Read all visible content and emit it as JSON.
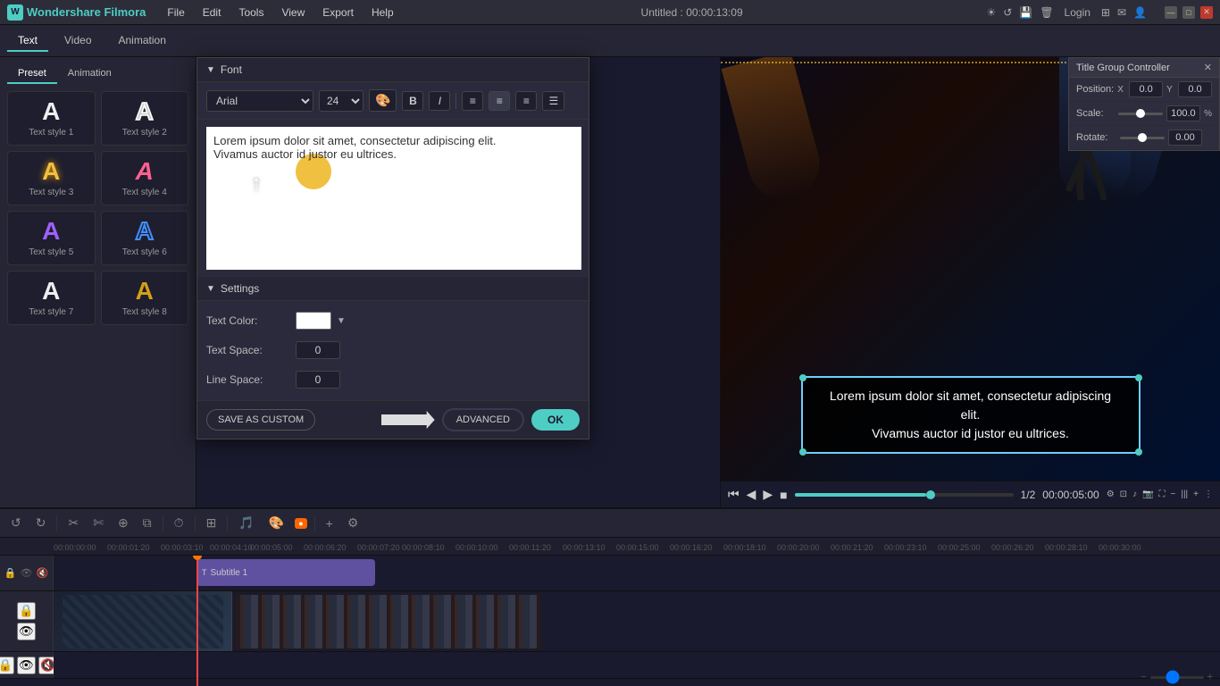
{
  "app": {
    "brand": "Wondershare Filmora",
    "title": "Untitled : 00:00:13:09"
  },
  "menubar": {
    "items": [
      "File",
      "Edit",
      "Tools",
      "View",
      "Export",
      "Help"
    ],
    "login": "Login",
    "window_controls": [
      "—",
      "□",
      "✕"
    ]
  },
  "toolbar": {
    "tabs": [
      "Text",
      "Video",
      "Animation"
    ],
    "preset_tabs": [
      "Preset",
      "Animation"
    ]
  },
  "text_styles": [
    {
      "label": "Text style 1",
      "letter": "A",
      "variant": "plain"
    },
    {
      "label": "Text style 2",
      "letter": "A",
      "variant": "outline"
    },
    {
      "label": "Text style 3",
      "letter": "A",
      "variant": "yellow"
    },
    {
      "label": "Text style 4",
      "letter": "A",
      "variant": "pink"
    },
    {
      "label": "Text style 5",
      "letter": "A",
      "variant": "purple"
    },
    {
      "label": "Text style 6",
      "letter": "A",
      "variant": "blue-outline"
    },
    {
      "label": "Text style 7",
      "letter": "A",
      "variant": "plain2"
    },
    {
      "label": "Text style 8",
      "letter": "A",
      "variant": "gold"
    }
  ],
  "font_editor": {
    "section_title": "Font",
    "font_family": "Arial",
    "font_size": "24",
    "preview_text": "Lorem ipsum dolor sit amet, consectetur adipiscing elit.\nVivamus auctor id justor eu ultrices.",
    "settings_title": "Settings",
    "text_color_label": "Text Color:",
    "text_space_label": "Text Space:",
    "text_space_val": "0",
    "line_space_label": "Line Space:",
    "line_space_val": "0"
  },
  "footer_buttons": {
    "save_custom": "SAVE AS CUSTOM",
    "advanced": "ADVANCED",
    "ok": "OK"
  },
  "tgc": {
    "title": "Title Group Controller",
    "close": "✕",
    "position_label": "Position:",
    "x_axis": "X",
    "y_axis": "Y",
    "x_val": "0.0",
    "y_val": "0.0",
    "scale_label": "Scale:",
    "scale_val": "100.00",
    "scale_unit": "%",
    "rotate_label": "Rotate:",
    "rotate_val": "0.00"
  },
  "preview": {
    "subtitle_line1": "Lorem ipsum dolor sit amet, consectetur adipiscing elit.",
    "subtitle_line2": "Vivamus auctor id justor eu ultrices.",
    "time_display": "00:00:05:00",
    "page_indicator": "1/2"
  },
  "timeline": {
    "timestamps": [
      "00:00:00:00",
      "00:00:01:20",
      "00:00:03:10",
      "00:00:04:10",
      "00:00:05:00",
      "00:00:06:20",
      "00:00:07:20",
      "00:00:08:10",
      "00:00:10:00",
      "00:00:11:20",
      "00:00:13:10",
      "00:00:15:00",
      "00:00:16:20",
      "00:00:18:10",
      "00:00:20:00",
      "00:00:21:20",
      "00:00:23:10",
      "00:00:25:00",
      "00:00:26:20",
      "00:00:28:10",
      "00:00:30:00"
    ],
    "clip_label": "Subtitle 1",
    "total_time": "00:00:05:00"
  }
}
